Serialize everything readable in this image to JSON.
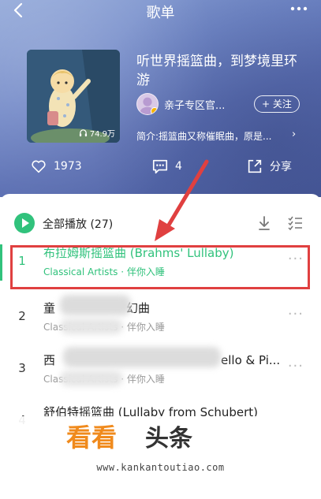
{
  "header": {
    "title": "歌单"
  },
  "playlist": {
    "cover_play_count": "74.9万",
    "title": "听世界摇篮曲，到梦境里环游",
    "creator_name": "亲子专区官...",
    "follow_label": "+ 关注",
    "intro": "简介:摇篮曲又称催眠曲，原是..."
  },
  "actions": {
    "likes": "1973",
    "comments": "4",
    "share_label": "分享"
  },
  "list": {
    "play_all_label": "全部播放 (27)",
    "songs": [
      {
        "index": "1",
        "title": "布拉姆斯摇篮曲 (Brahms' Lullaby)",
        "subtitle": "Classical Artists · 伴你入睡"
      },
      {
        "index": "2",
        "title": "童",
        "title_tail": "幻曲",
        "subtitle": "Classical Artists · 伴你入睡"
      },
      {
        "index": "3",
        "title": "西",
        "title_tail": "ello & Pi...",
        "subtitle": "Classical Artists · 伴你入睡"
      },
      {
        "index": "4",
        "title": "舒伯特摇篮曲 (Lullaby from Schubert)",
        "subtitle": ""
      }
    ]
  },
  "watermark": {
    "brand": "看看头条",
    "url": "www.kankantoutiao.com"
  },
  "colors": {
    "accent": "#31c27c",
    "highlight": "#e04040"
  }
}
